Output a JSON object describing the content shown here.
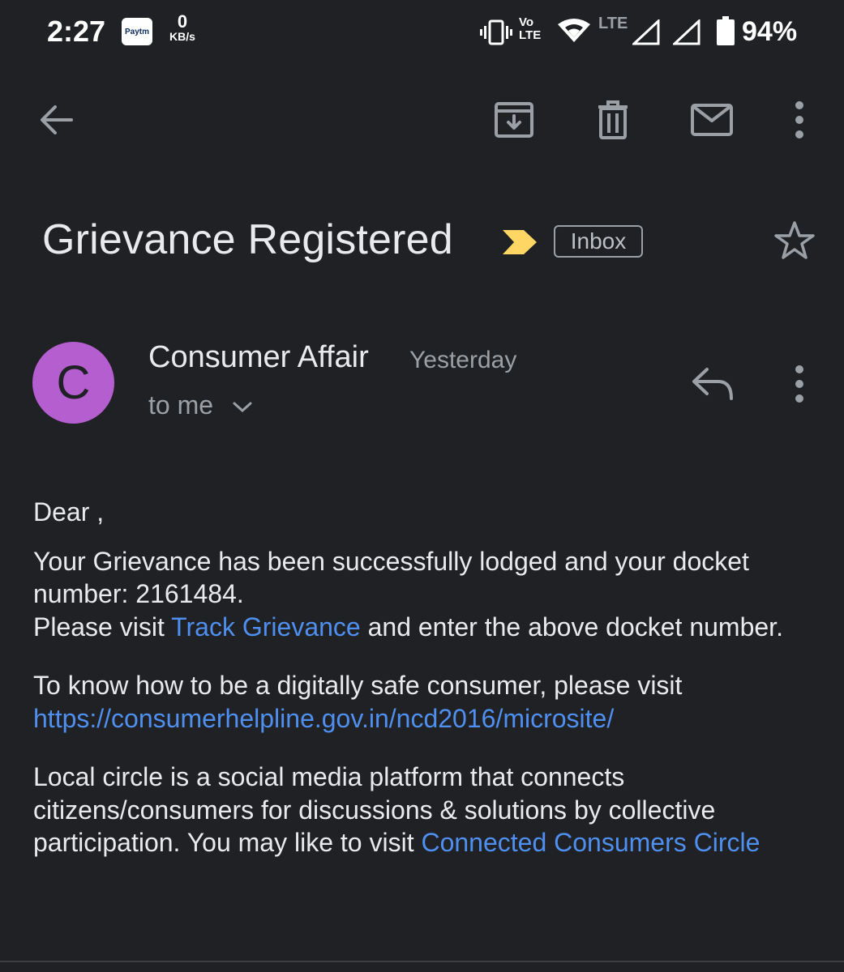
{
  "status_bar": {
    "time": "2:27",
    "paytm_label": "Paytm",
    "net_speed_value": "0",
    "net_speed_unit": "KB/s",
    "volte_label_top": "Vo",
    "volte_label_bottom": "LTE",
    "lte_label": "LTE",
    "battery": "94%",
    "icons": [
      "vibrate-icon",
      "volte-icon",
      "wifi-icon",
      "signal-icon",
      "signal-icon",
      "battery-icon"
    ]
  },
  "toolbar": {
    "icons": [
      "back-arrow-icon",
      "archive-icon",
      "delete-icon",
      "mark-unread-icon",
      "more-vert-icon"
    ]
  },
  "email": {
    "subject": "Grievance Registered",
    "label": "Inbox",
    "important_color": "#fdd663",
    "sender": {
      "initial": "C",
      "avatar_color": "#b55ed0",
      "name": "Consumer Affair",
      "time": "Yesterday",
      "to": "to me"
    },
    "body": {
      "greeting": "Dear ,",
      "p1_line1": "Your Grievance has been successfully lodged and your docket number: 2161484.",
      "p1_visit_prefix": "Please visit ",
      "p1_link": "Track Grievance",
      "p1_visit_suffix": " and enter the above docket number.",
      "p2_text": "To know how to be a digitally safe consumer, please visit",
      "p2_link": "https://consumerhelpline.gov.in/ncd2016/microsite/",
      "p3_text": "Local circle is a social media platform that connects citizens/consumers for discussions & solutions by collective participation. You may like to visit ",
      "p3_link": "Connected Consumers Circle"
    }
  },
  "colors": {
    "background": "#202124",
    "link": "#4f8ff0",
    "text": "#e8eaed",
    "muted": "#9aa0a6"
  }
}
